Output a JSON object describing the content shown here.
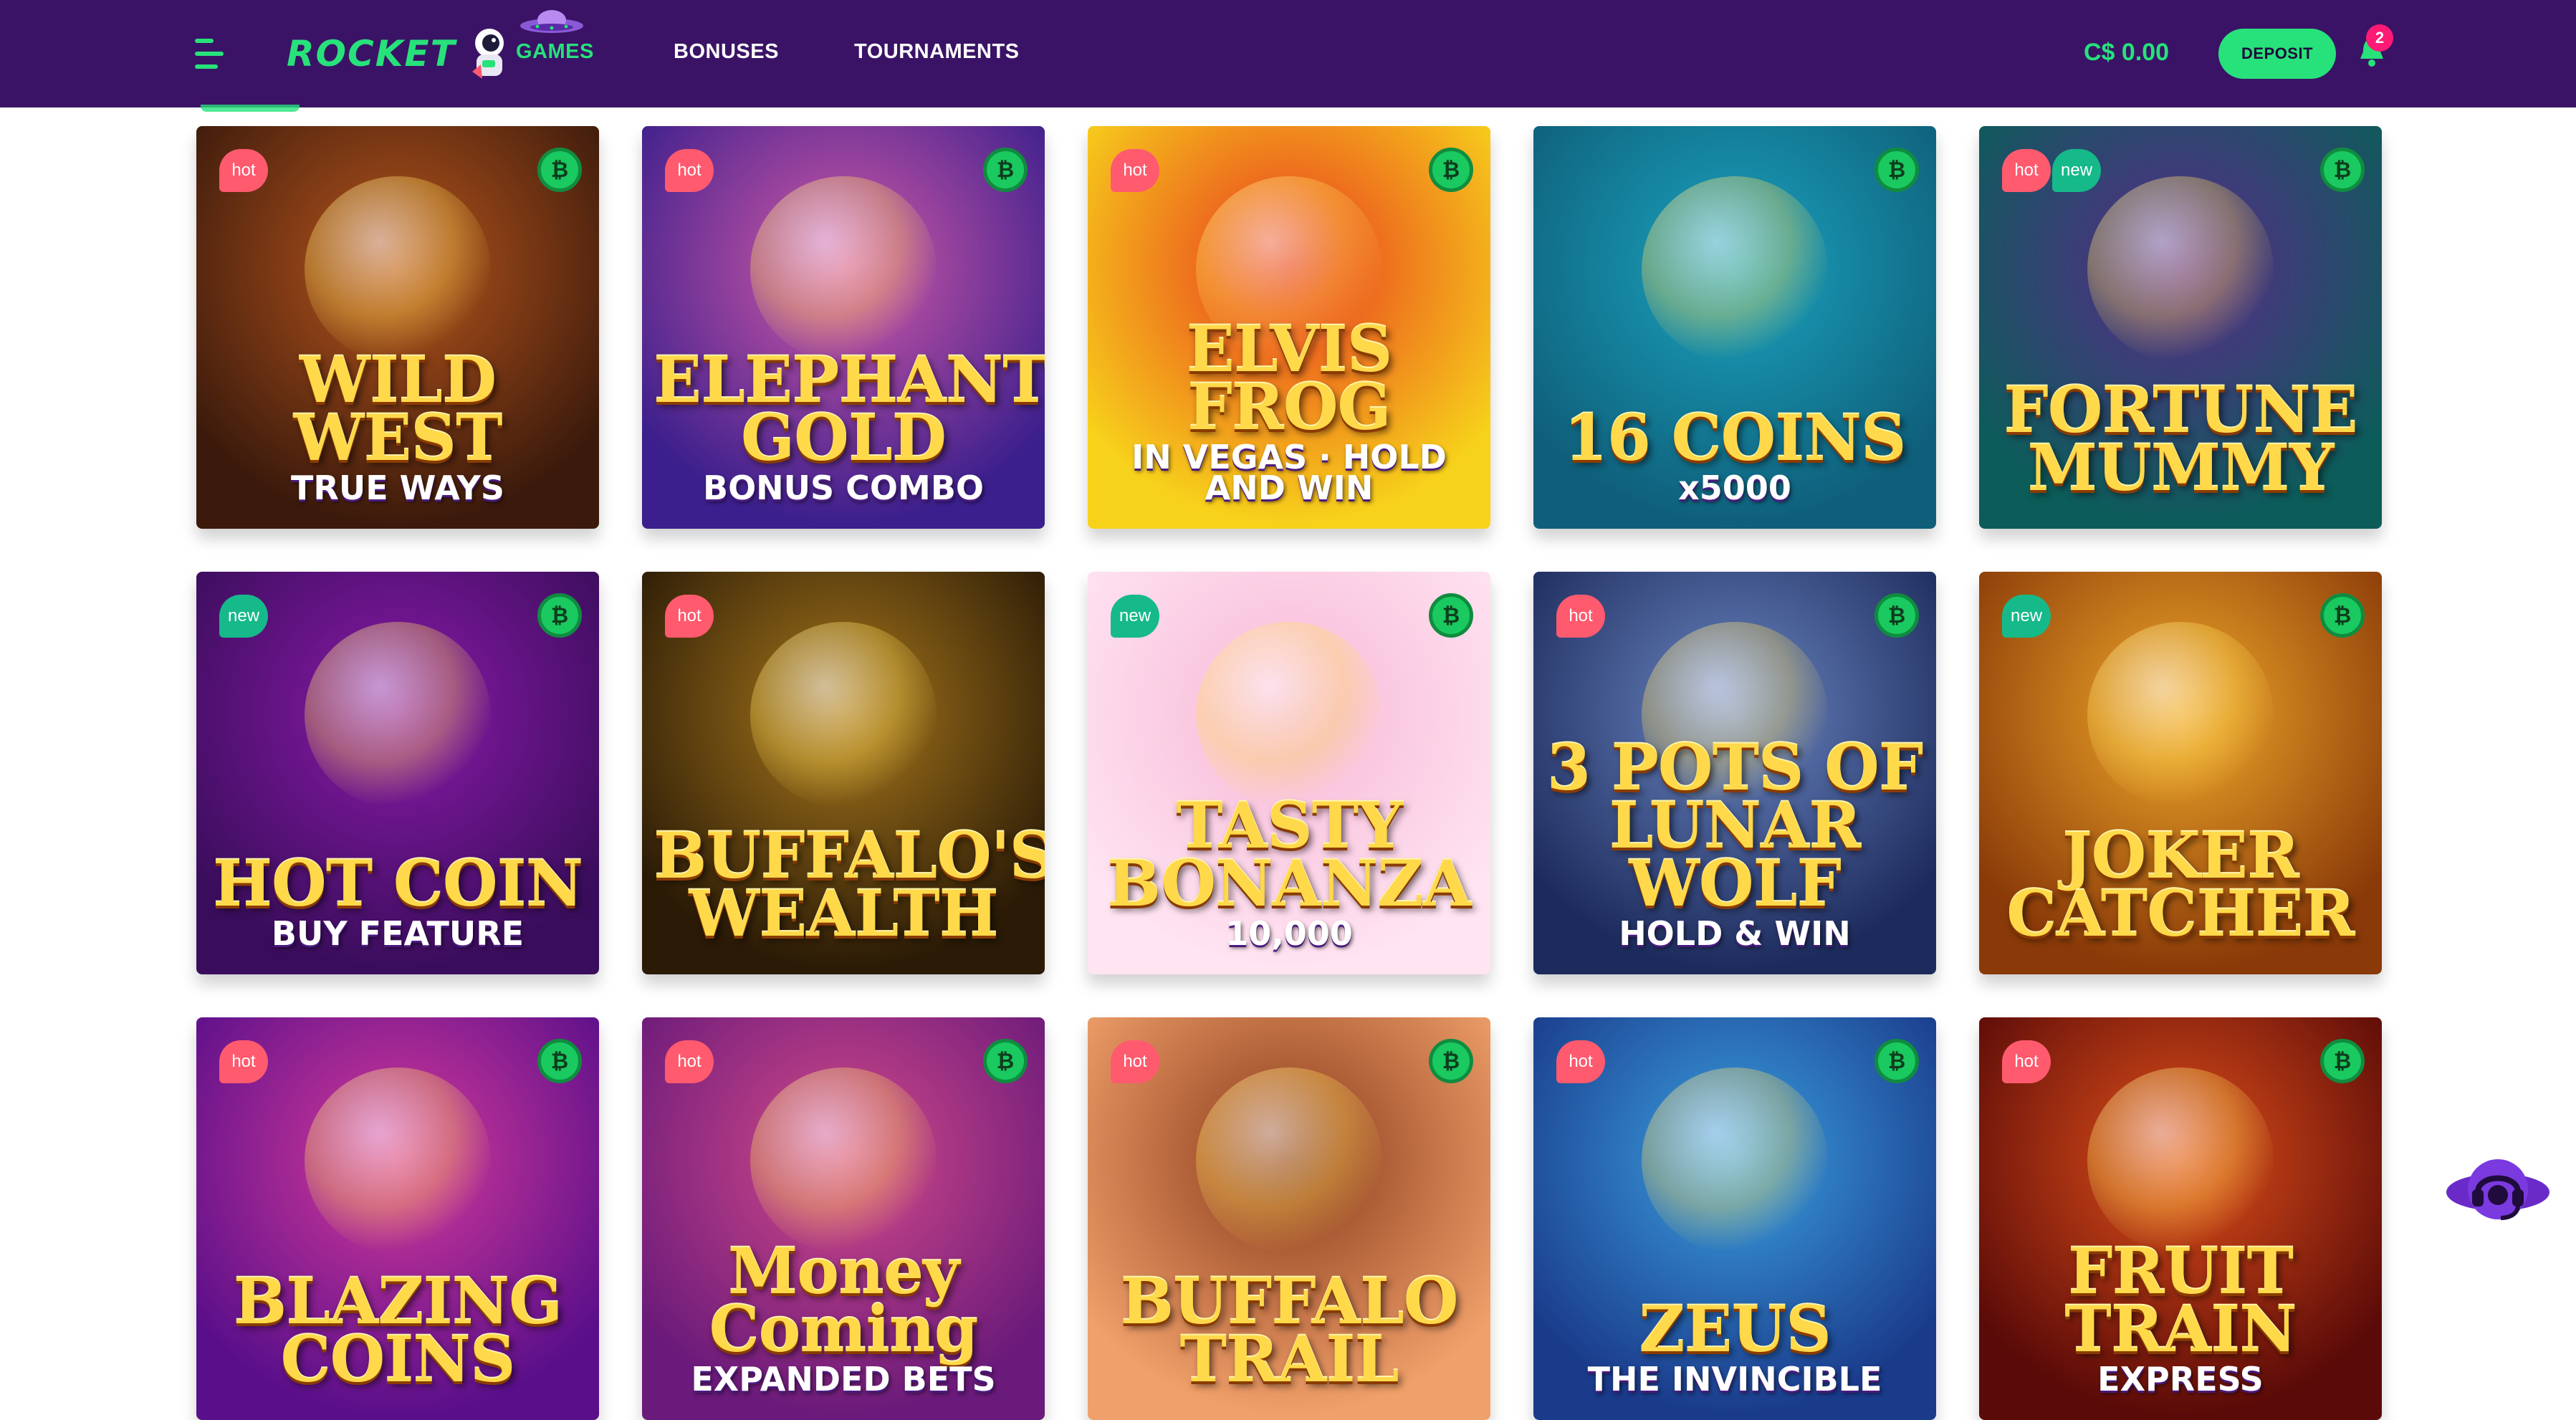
{
  "header": {
    "logo_text": "ROCKET",
    "nav": [
      {
        "label": "GAMES",
        "active": true
      },
      {
        "label": "BONUSES",
        "active": false
      },
      {
        "label": "TOURNAMENTS",
        "active": false
      }
    ],
    "balance": "C$ 0.00",
    "deposit_label": "DEPOSIT",
    "notification_count": "2"
  },
  "colors": {
    "header_bg": "#3a1366",
    "accent": "#27e27a",
    "hot_badge": "#ff5a6e",
    "new_badge": "#16b98a",
    "notification": "#ff1a75"
  },
  "games": [
    {
      "title": "WILD WEST",
      "subtitle": "TRUE WAYS",
      "badges": [
        "hot"
      ],
      "crypto": true,
      "bg": [
        "#3b1a0c",
        "#b8561c"
      ]
    },
    {
      "title": "ELEPHANT'S GOLD",
      "subtitle": "BONUS COMBO",
      "badges": [
        "hot"
      ],
      "crypto": true,
      "bg": [
        "#3b1f8c",
        "#d45aa8"
      ]
    },
    {
      "title": "ELVIS FROG",
      "subtitle": "IN VEGAS · HOLD AND WIN",
      "badges": [
        "hot"
      ],
      "crypto": true,
      "bg": [
        "#f7d21b",
        "#e8371f"
      ]
    },
    {
      "title": "16 COINS",
      "subtitle": "x5000",
      "badges": [],
      "crypto": true,
      "bg": [
        "#0f5f7a",
        "#1aa3bf"
      ]
    },
    {
      "title": "FORTUNE MUMMY",
      "subtitle": "",
      "badges": [
        "hot",
        "new"
      ],
      "crypto": true,
      "bg": [
        "#0c5c5a",
        "#5a2a8a"
      ]
    },
    {
      "title": "HOT COIN",
      "subtitle": "BUY FEATURE",
      "badges": [
        "new"
      ],
      "crypto": true,
      "bg": [
        "#3a0d5c",
        "#8a1aa8"
      ]
    },
    {
      "title": "BUFFALO'S WEALTH",
      "subtitle": "",
      "badges": [
        "hot"
      ],
      "crypto": false,
      "bg": [
        "#2a1a06",
        "#a8781c"
      ]
    },
    {
      "title": "TASTY BONANZA",
      "subtitle": "10,000",
      "badges": [
        "new"
      ],
      "crypto": true,
      "bg": [
        "#ffe4f2",
        "#f7b8d6"
      ]
    },
    {
      "title": "3 POTS OF LUNAR WOLF",
      "subtitle": "HOLD & WIN",
      "badges": [
        "hot"
      ],
      "crypto": true,
      "bg": [
        "#1d2b5c",
        "#6a86c2"
      ]
    },
    {
      "title": "JOKER CATCHER",
      "subtitle": "",
      "badges": [
        "new"
      ],
      "crypto": true,
      "bg": [
        "#8a3a08",
        "#f0a82a"
      ]
    },
    {
      "title": "BLAZING COINS",
      "subtitle": "",
      "badges": [
        "hot"
      ],
      "crypto": true,
      "bg": [
        "#5a0f8a",
        "#d63a9a"
      ]
    },
    {
      "title": "Money Coming",
      "subtitle": "EXPANDED BETS",
      "badges": [
        "hot"
      ],
      "crypto": true,
      "bg": [
        "#6a1a7a",
        "#d44a8a"
      ]
    },
    {
      "title": "BUFFALO TRAIL",
      "subtitle": "",
      "badges": [
        "hot"
      ],
      "crypto": true,
      "bg": [
        "#f0a06a",
        "#8a3a1a"
      ]
    },
    {
      "title": "ZEUS",
      "subtitle": "THE INVINCIBLE",
      "badges": [
        "hot"
      ],
      "crypto": true,
      "bg": [
        "#1a3a8a",
        "#3aa0e0"
      ]
    },
    {
      "title": "FRUIT TRAIN",
      "subtitle": "EXPRESS",
      "badges": [
        "hot"
      ],
      "crypto": true,
      "bg": [
        "#5a0a08",
        "#e0501a"
      ]
    }
  ]
}
